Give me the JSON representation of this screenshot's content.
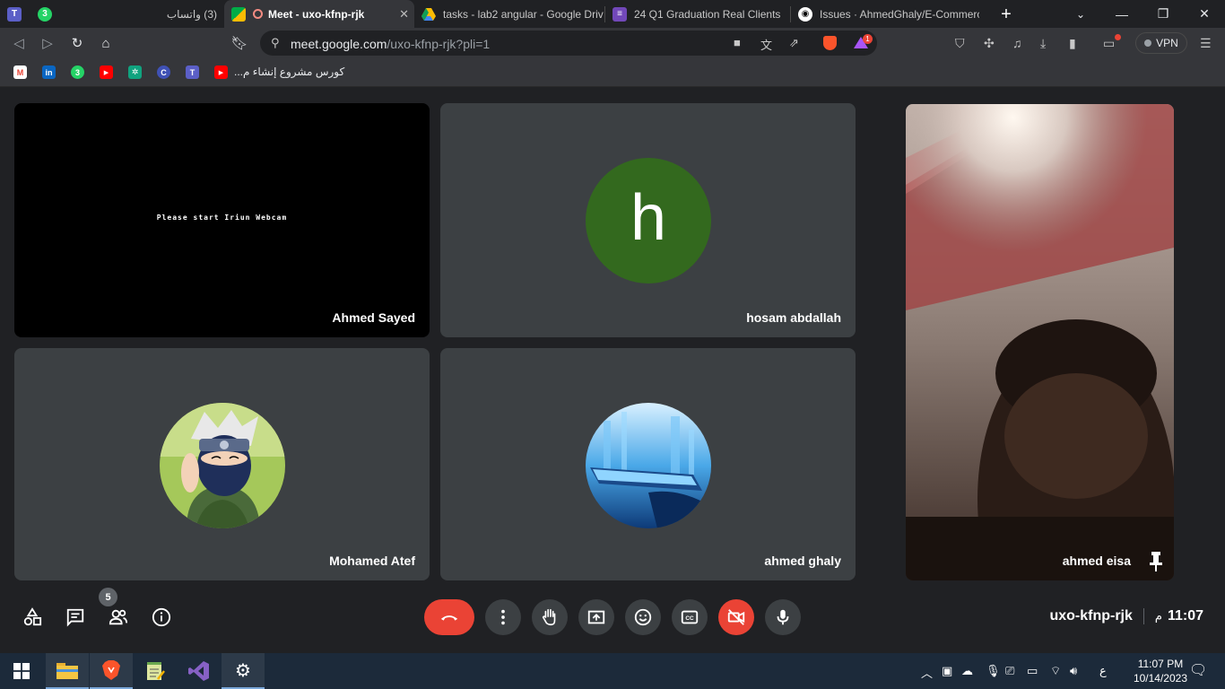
{
  "browser": {
    "tabs": [
      {
        "label": "",
        "icon": "teams-icon",
        "color": "#5b5fc7"
      },
      {
        "label": "",
        "icon": "whatsapp-icon",
        "color": "#25d366"
      },
      {
        "label": "(3) واتساب",
        "icon": "",
        "color": ""
      },
      {
        "label": "Meet - uxo-kfnp-rjk",
        "icon": "meet-icon",
        "color": "#00ac47",
        "active": true
      },
      {
        "label": "tasks - lab2 angular - Google Driv",
        "icon": "drive-icon",
        "color": "#fbbc04"
      },
      {
        "label": "24 Q1 Graduation Real Clients",
        "icon": "forms-icon",
        "color": "#7248b9"
      },
      {
        "label": "Issues · AhmedGhaly/E-Commerc",
        "icon": "github-icon",
        "color": "#ffffff"
      }
    ],
    "new_tab": "+",
    "url_host": "meet.google.com",
    "url_path": "/uxo-kfnp-rjk?pli=1",
    "brave_badge": "1",
    "vpn_label": "VPN"
  },
  "bookmarks": {
    "icons": [
      {
        "name": "gmail-bookmark-icon",
        "color": "#ea4335",
        "glyph": "M"
      },
      {
        "name": "linkedin-bookmark-icon",
        "color": "#0a66c2",
        "glyph": "in"
      },
      {
        "name": "whatsapp-bookmark-icon",
        "color": "#25d366",
        "glyph": "3"
      },
      {
        "name": "youtube-bookmark-icon",
        "color": "#ff0000",
        "glyph": "▶"
      },
      {
        "name": "chatgpt-bookmark-icon",
        "color": "#10a37f",
        "glyph": "✲"
      },
      {
        "name": "app-bookmark-icon",
        "color": "#3f51b5",
        "glyph": "C"
      },
      {
        "name": "teams-bookmark-icon",
        "color": "#5b5fc7",
        "glyph": "T"
      },
      {
        "name": "youtube-course-bookmark-icon",
        "color": "#ff0000",
        "glyph": "▶"
      }
    ],
    "course_label": "كورس مشروع إنشاء م..."
  },
  "meet": {
    "tiles": [
      {
        "name": "Ahmed Sayed",
        "type": "video-black",
        "message": "Please start Iriun Webcam"
      },
      {
        "name": "hosam abdallah",
        "type": "letter",
        "letter": "h",
        "color": "#33691e"
      },
      {
        "name": "Mohamed Atef",
        "type": "avatar-anime"
      },
      {
        "name": "ahmed ghaly",
        "type": "avatar-tech"
      }
    ],
    "self_view": {
      "name": "ahmed eisa",
      "pinned": true
    },
    "participants_count": "5",
    "meeting_code": "uxo-kfnp-rjk",
    "time": "11:07",
    "time_suffix": "م",
    "colors": {
      "hangup": "#ea4335",
      "tile": "#3c4043",
      "background": "#202124"
    }
  },
  "taskbar": {
    "apps": [
      "start-icon",
      "file-explorer-icon",
      "brave-icon",
      "notepad-icon",
      "visual-studio-icon",
      "settings-icon"
    ],
    "language": "ع",
    "clock_time": "11:07 PM",
    "clock_date": "10/14/2023"
  }
}
